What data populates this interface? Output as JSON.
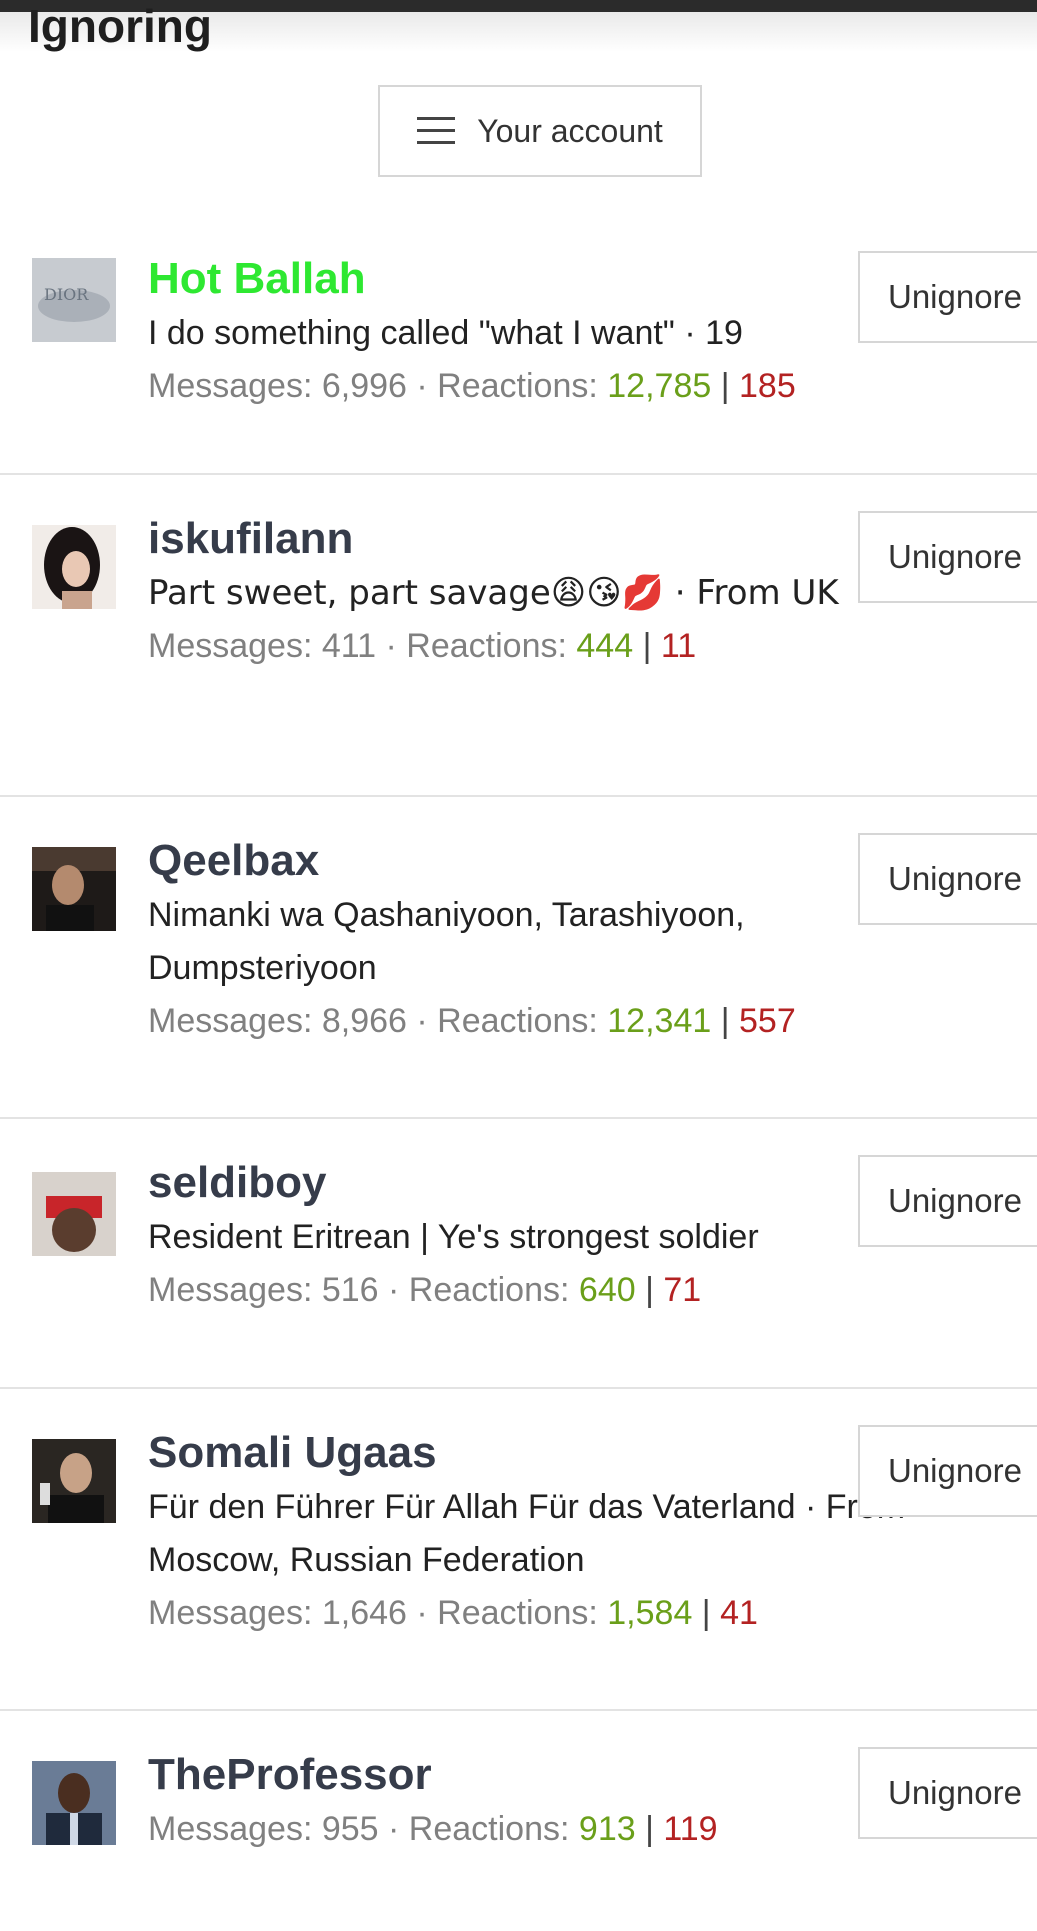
{
  "page": {
    "title": "Ignoring"
  },
  "header": {
    "account_label": "Your account"
  },
  "unignore_label": "Unignore",
  "users": [
    {
      "name": "Hot Ballah",
      "name_color": "#2ee831",
      "about": "I do something called \"what I want\" · 19",
      "messages": "6,996",
      "reactions_pos": "12,785",
      "reactions_neg": "185"
    },
    {
      "name": "iskufilann",
      "about": "Part sweet, part savage😩😘💋 · From UK",
      "messages": "411",
      "reactions_pos": "444",
      "reactions_neg": "11"
    },
    {
      "name": "Qeelbax",
      "about": "Nimanki wa Qashaniyoon, Tarashiyoon, Dumpsteriyoon",
      "messages": "8,966",
      "reactions_pos": "12,341",
      "reactions_neg": "557"
    },
    {
      "name": "seldiboy",
      "about": "Resident Eritrean | Ye's strongest soldier",
      "messages": "516",
      "reactions_pos": "640",
      "reactions_neg": "71"
    },
    {
      "name": "Somali Ugaas",
      "about": "Für den Führer Für Allah Für das Vaterland · From Moscow, Russian Federation",
      "messages": "1,646",
      "reactions_pos": "1,584",
      "reactions_neg": "41"
    },
    {
      "name": "TheProfessor",
      "messages": "955",
      "reactions_pos": "913",
      "reactions_neg": "119"
    }
  ],
  "labels": {
    "messages": "Messages: ",
    "reactions": " · Reactions: ",
    "divider": " | "
  },
  "colors": {
    "positive": "#6a9f1a",
    "negative": "#b32222",
    "username": "#363c4a"
  }
}
